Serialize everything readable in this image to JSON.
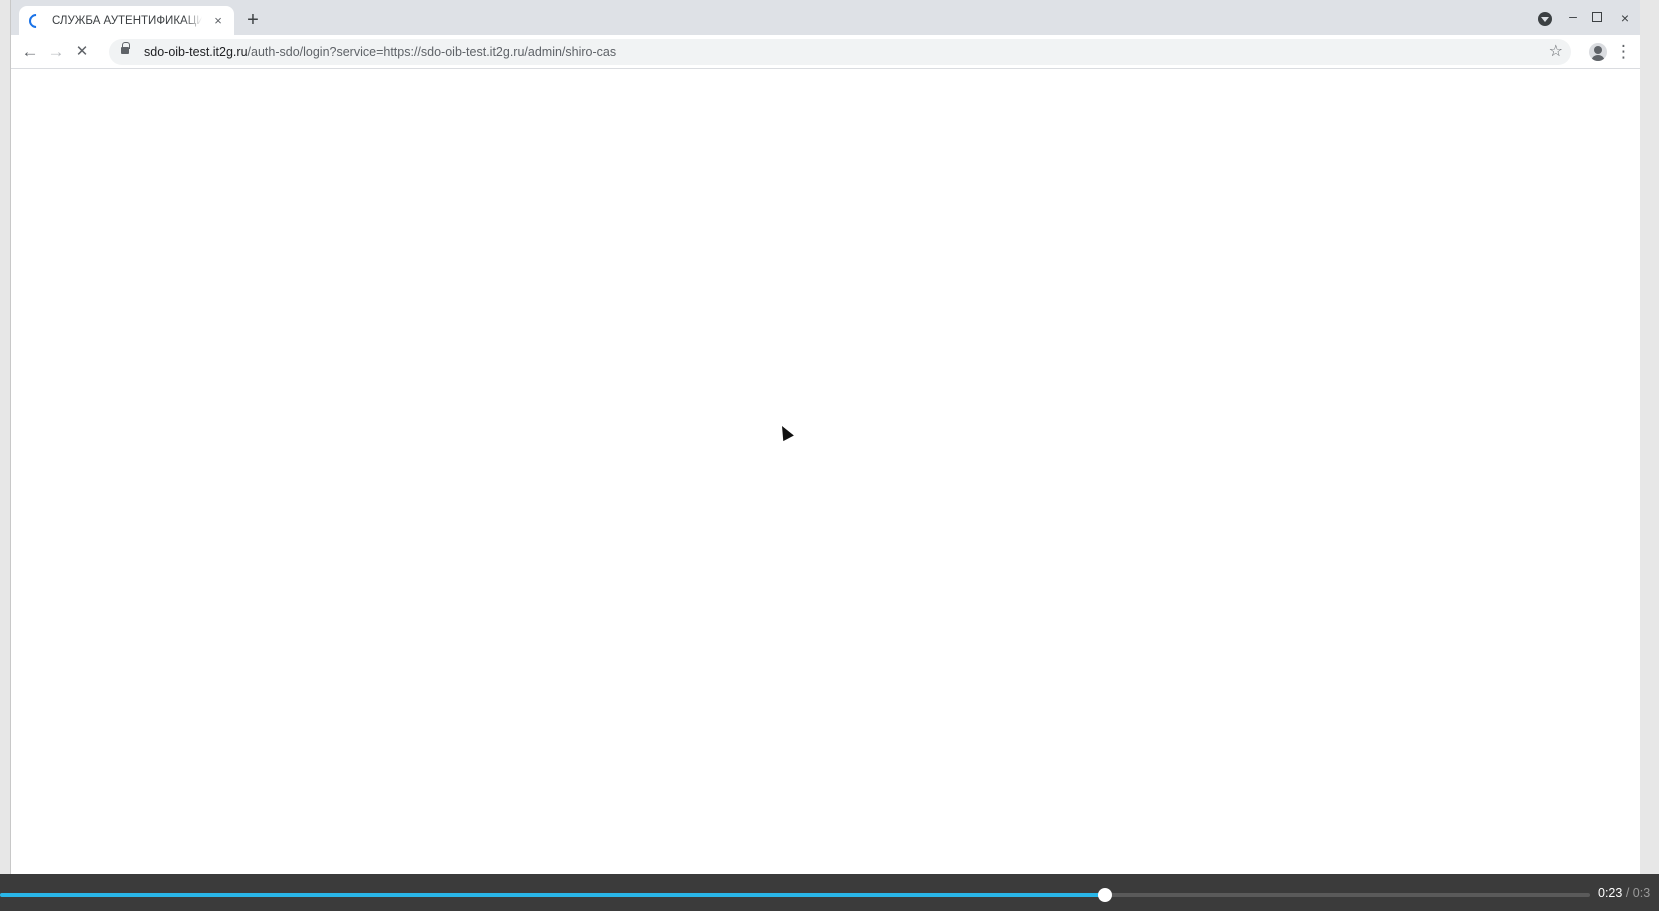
{
  "browser": {
    "tab": {
      "title": "СЛУЖБА АУТЕНТИФИКАЦИ",
      "close_glyph": "×",
      "loading": true
    },
    "new_tab_glyph": "+",
    "window_controls": {
      "minimize_glyph": "–",
      "close_glyph": "×"
    },
    "toolbar": {
      "back_glyph": "←",
      "forward_glyph": "→",
      "stop_glyph": "✕",
      "menu_glyph": "⋮",
      "star_glyph": "☆"
    },
    "address": {
      "host": "sdo-oib-test.it2g.ru",
      "path": "/auth-sdo/login?service=https://sdo-oib-test.it2g.ru/admin/shiro-cas"
    },
    "accent_color": "#1a73e8"
  },
  "player": {
    "current_time": "0:23",
    "separator": " / ",
    "total_time": "0:3",
    "progress_fraction": 0.695,
    "progress_color": "#29b6e8"
  }
}
